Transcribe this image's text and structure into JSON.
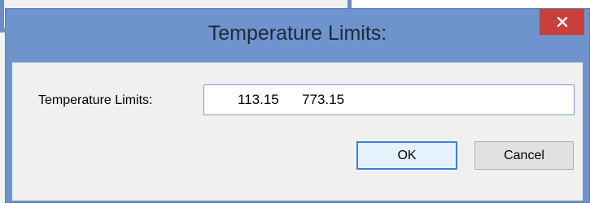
{
  "dialog": {
    "title": "Temperature Limits:",
    "close_icon": "close-icon",
    "field_label": "Temperature Limits:",
    "field_value": "113.15      773.15",
    "ok_label": "OK",
    "cancel_label": "Cancel"
  },
  "colors": {
    "titlebar": "#6f93cc",
    "close_button": "#c7413a",
    "client_background": "#f0f0f0",
    "focus_border": "#3c7fd6"
  }
}
